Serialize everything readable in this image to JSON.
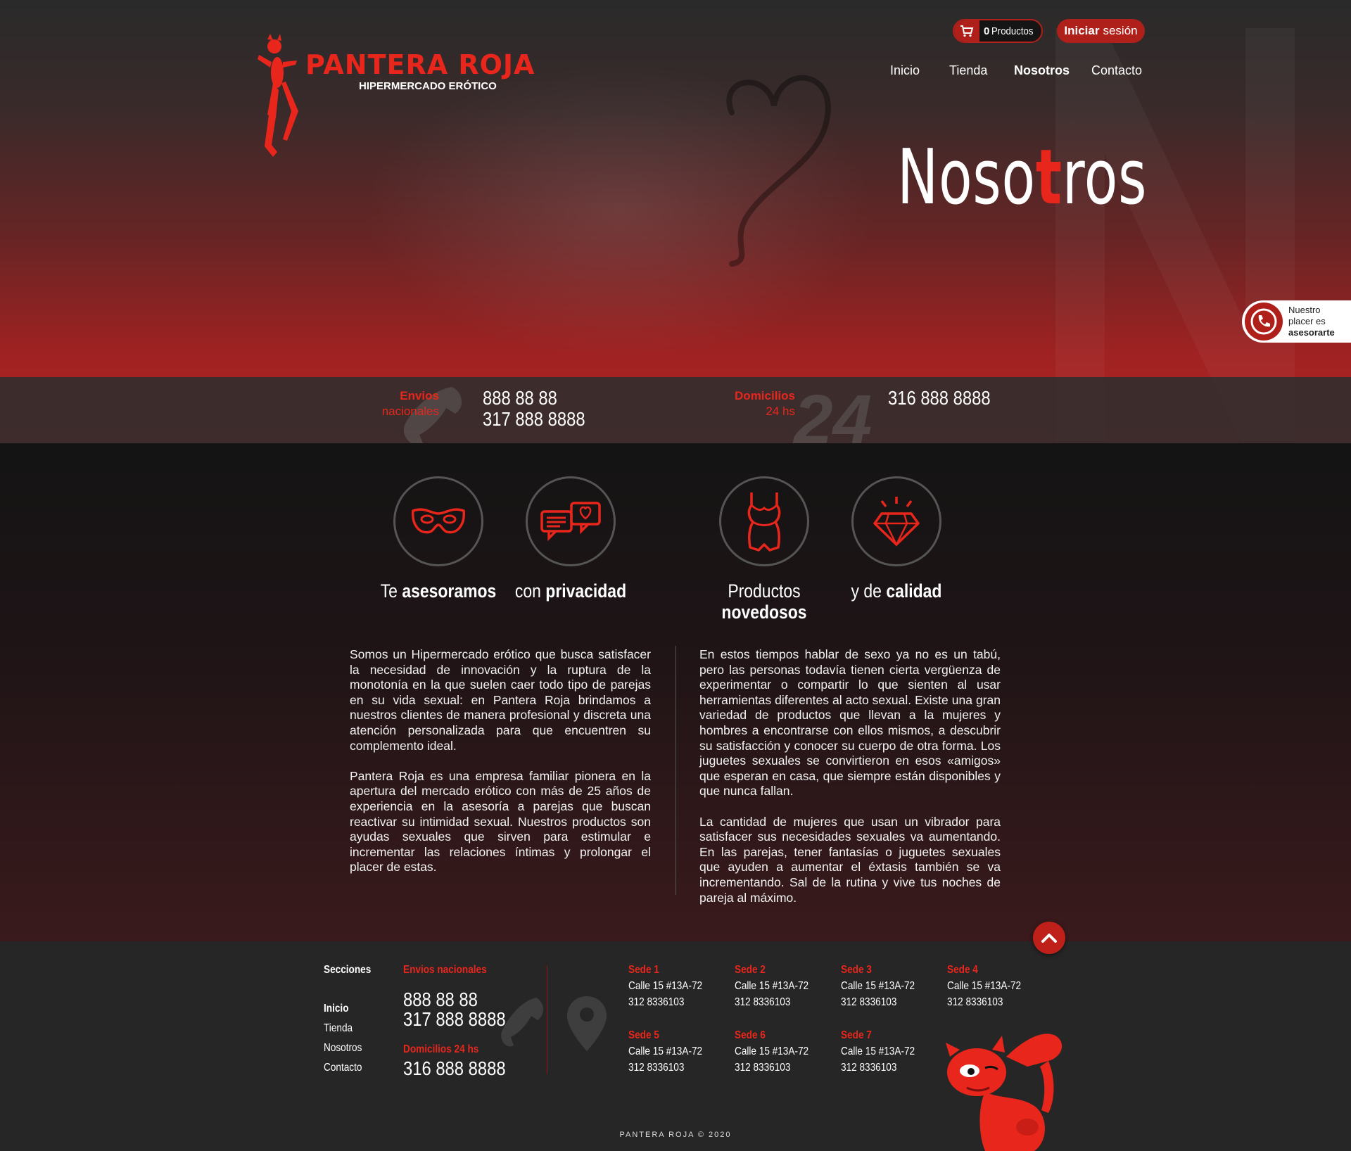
{
  "brand": {
    "name": "PANTERA ROJA",
    "tagline": "HIPERMERCADO ERÓTICO",
    "accent": "#e8261c",
    "dark_red": "#b0201a"
  },
  "header": {
    "cart_count": "0",
    "cart_label": "Productos",
    "login_bold": "Iniciar",
    "login_rest": "sesión",
    "nav": [
      {
        "label": "Inicio",
        "active": false
      },
      {
        "label": "Tienda",
        "active": false
      },
      {
        "label": "Nosotros",
        "active": true
      },
      {
        "label": "Contacto",
        "active": false
      }
    ]
  },
  "hero": {
    "title_a": "Noso",
    "title_b": "t",
    "title_c": "ros"
  },
  "whatsapp": {
    "line1": "Nuestro",
    "line2": "placer es",
    "line3": "asesorarte"
  },
  "contact_band": {
    "envios_bold": "Envios",
    "envios_rest": "nacionales",
    "envios_phone1": "888 88 88",
    "envios_phone2": "317 888 8888",
    "dom_bold": "Domicilios",
    "dom_rest": "24 hs",
    "dom_phone": "316 888 8888",
    "dom_watermark": "24"
  },
  "features": [
    {
      "icon": "mask-icon",
      "light": "Te",
      "bold": "asesoramos"
    },
    {
      "icon": "chat-bubbles-icon",
      "light": "con",
      "bold": "privacidad"
    },
    {
      "icon": "lingerie-icon",
      "light": "Productos",
      "bold": "novedosos"
    },
    {
      "icon": "diamond-icon",
      "light": "y de",
      "bold": "calidad"
    }
  ],
  "about": {
    "left": [
      "Somos un Hipermercado erótico que busca satisfacer la necesidad de innovación y la ruptura de la monotonía en la que suelen caer todo tipo de parejas en su vida sexual: en Pantera Roja brindamos a nuestros clientes de manera profesional y discreta una atención personalizada para que encuentren su complemento ideal.",
      "Pantera Roja es una empresa familiar pionera en la apertura del mercado erótico con más de 25 años de experiencia en la asesoría a parejas que buscan reactivar su intimidad sexual. Nuestros productos son ayudas sexuales que sirven para estimular e incrementar las relaciones íntimas y prolongar el placer de estas."
    ],
    "right": [
      "En estos tiempos hablar de sexo ya no es un tabú, pero las personas todavía tienen cierta vergüenza de experimentar o compartir lo que sienten al usar herramientas diferentes al acto sexual. Existe una gran variedad de productos que llevan a la mujeres y hombres a encontrarse con ellos mismos, a descubrir su satisfacción y conocer su cuerpo de otra forma. Los juguetes sexuales se convirtieron en esos «amigos» que esperan en casa, que siempre están disponibles y que nunca fallan.",
      "La cantidad de mujeres que usan un vibrador para satisfacer sus necesidades sexuales va aumentando. En las parejas, tener fantasías o juguetes sexuales que ayuden a aumentar el éxtasis también se va incrementando. Sal de la rutina y vive tus noches de pareja al máximo."
    ]
  },
  "footer": {
    "sections_title": "Secciones",
    "sections": [
      "Inicio",
      "Tienda",
      "Nosotros",
      "Contacto"
    ],
    "envios_title": "Envios nacionales",
    "envios_phone1": "888 88 88",
    "envios_phone2": "317 888 8888",
    "dom_title": "Domicilios 24 hs",
    "dom_phone": "316 888 8888",
    "sedes": [
      {
        "name": "Sede 1",
        "address": "Calle 15 #13A-72",
        "phone": "312 8336103"
      },
      {
        "name": "Sede 2",
        "address": "Calle 15 #13A-72",
        "phone": "312 8336103"
      },
      {
        "name": "Sede 3",
        "address": "Calle 15 #13A-72",
        "phone": "312 8336103"
      },
      {
        "name": "Sede 4",
        "address": "Calle 15 #13A-72",
        "phone": "312 8336103"
      },
      {
        "name": "Sede 5",
        "address": "Calle 15 #13A-72",
        "phone": "312 8336103"
      },
      {
        "name": "Sede 6",
        "address": "Calle 15 #13A-72",
        "phone": "312 8336103"
      },
      {
        "name": "Sede 7",
        "address": "Calle 15 #13A-72",
        "phone": "312 8336103"
      }
    ],
    "copyright": "PANTERA ROJA © 2020"
  }
}
